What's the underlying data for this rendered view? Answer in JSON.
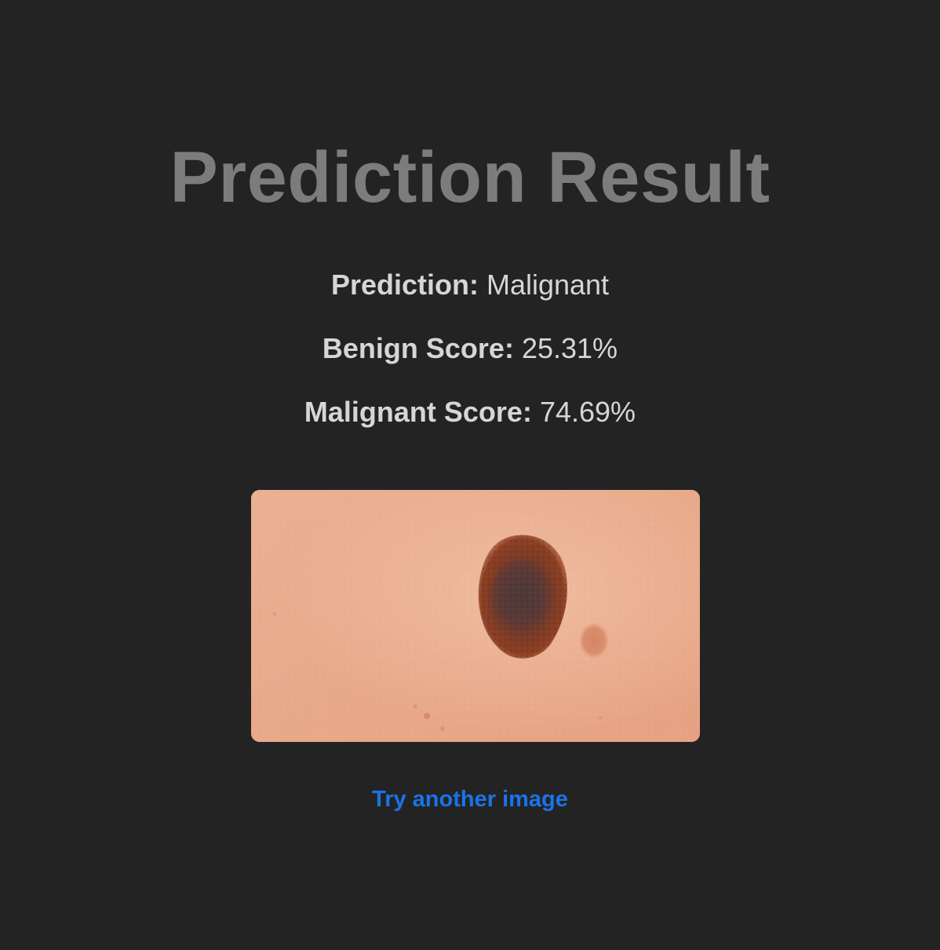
{
  "page": {
    "title": "Prediction Result"
  },
  "results": {
    "prediction_label": "Prediction:",
    "prediction_value": "Malignant",
    "benign_label": "Benign Score:",
    "benign_value": "25.31%",
    "malignant_label": "Malignant Score:",
    "malignant_value": "74.69%"
  },
  "image": {
    "subject": "skin-lesion-photo"
  },
  "actions": {
    "try_another_label": "Try another image"
  },
  "colors": {
    "background": "#232323",
    "title": "#7c7c7c",
    "text": "#d6d6d6",
    "link": "#1a73e8"
  }
}
